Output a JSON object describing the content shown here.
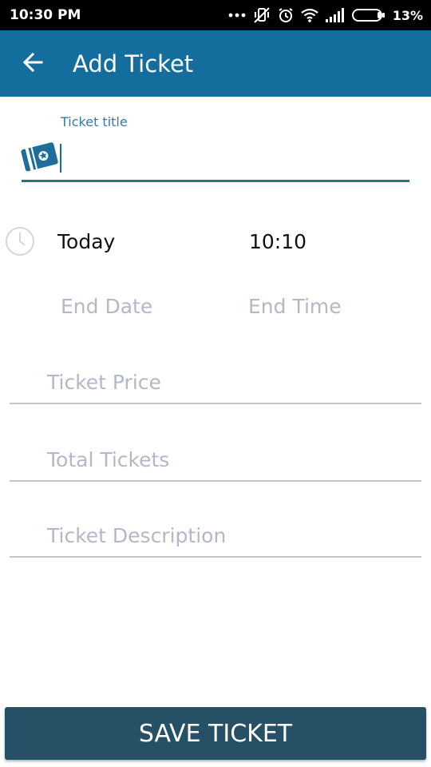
{
  "status_bar": {
    "time": "10:30 PM",
    "battery_percent": "13%",
    "icons": [
      "more-dots-icon",
      "vibrate-off-icon",
      "alarm-clock-icon",
      "wifi-icon",
      "signal-icon",
      "battery-icon"
    ]
  },
  "app_bar": {
    "title": "Add Ticket",
    "back_icon": "arrow-left-icon",
    "color": "#136e9e"
  },
  "form": {
    "ticket_title_label": "Ticket title",
    "ticket_title_value": "",
    "ticket_icon": "ticket-icon",
    "clock_icon": "clock-icon",
    "start_date": "Today",
    "start_time": "10:10",
    "end_date_placeholder": "End Date",
    "end_time_placeholder": "End Time",
    "ticket_price_placeholder": "Ticket Price",
    "total_tickets_placeholder": "Total Tickets",
    "ticket_description_placeholder": "Ticket Description"
  },
  "save_button": {
    "label": "SAVE TICKET",
    "color": "#265066"
  }
}
